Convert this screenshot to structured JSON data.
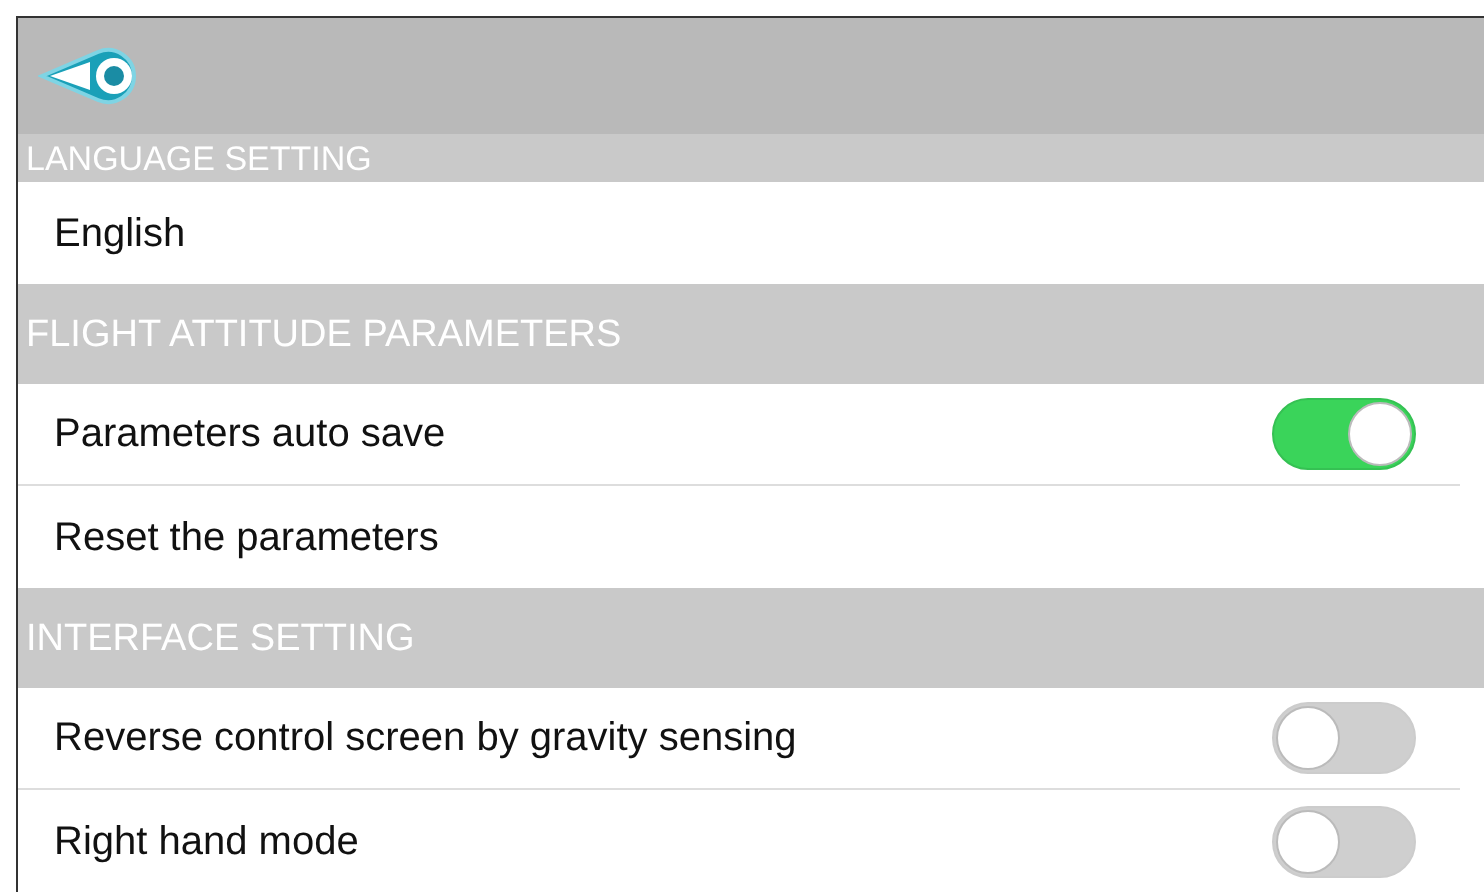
{
  "sections": [
    {
      "title": "LANGUAGE SETTING",
      "items": [
        {
          "kind": "text",
          "label": "English"
        }
      ]
    },
    {
      "title": "FLIGHT ATTITUDE PARAMETERS",
      "items": [
        {
          "kind": "toggle",
          "label": "Parameters auto save",
          "on": true
        },
        {
          "kind": "text",
          "label": "Reset the parameters"
        }
      ]
    },
    {
      "title": "INTERFACE SETTING",
      "items": [
        {
          "kind": "toggle",
          "label": "Reverse control screen by gravity sensing",
          "on": false
        },
        {
          "kind": "toggle",
          "label": "Right hand mode",
          "on": false
        }
      ]
    }
  ]
}
